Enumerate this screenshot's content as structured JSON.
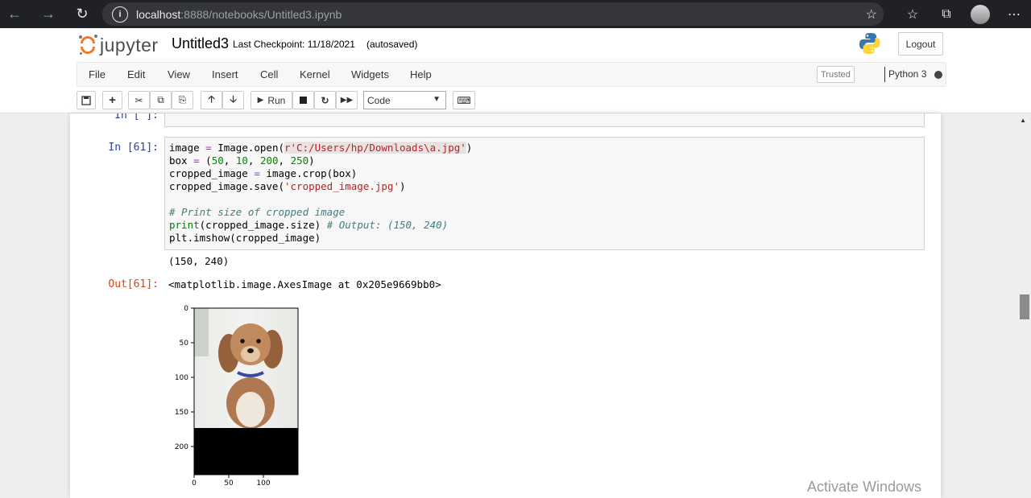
{
  "browser": {
    "url_host": "localhost",
    "url_path": ":8888/notebooks/Untitled3.ipynb"
  },
  "header": {
    "logo_text": "jupyter",
    "notebook_title": "Untitled3",
    "checkpoint": "Last Checkpoint: 11/18/2021",
    "autosave": "(autosaved)",
    "logout": "Logout"
  },
  "menu": {
    "items": [
      "File",
      "Edit",
      "View",
      "Insert",
      "Cell",
      "Kernel",
      "Widgets",
      "Help"
    ],
    "trusted": "Trusted",
    "kernel": "Python 3"
  },
  "toolbar": {
    "run_label": "Run",
    "cell_type": "Code"
  },
  "cells": {
    "prev_prompt": "In [ ]:",
    "in_prompt": "In [61]:",
    "out_prompt": "Out[61]:",
    "stdout": "(150, 240)",
    "result": "<matplotlib.image.AxesImage at 0x205e9669bb0>",
    "code": [
      "image = Image.open(r'C:/Users/hp/Downloads\\a.jpg')",
      "box = (50, 10, 200, 250)",
      "cropped_image = image.crop(box)",
      "cropped_image.save('cropped_image.jpg')",
      "",
      "# Print size of cropped image",
      "print(cropped_image.size) # Output: (150, 240)",
      "plt.imshow(cropped_image)"
    ]
  },
  "plot": {
    "y_ticks": [
      "0",
      "50",
      "100",
      "150",
      "200"
    ],
    "x_ticks": [
      "0",
      "50",
      "100"
    ]
  },
  "watermark": "Activate Windows"
}
